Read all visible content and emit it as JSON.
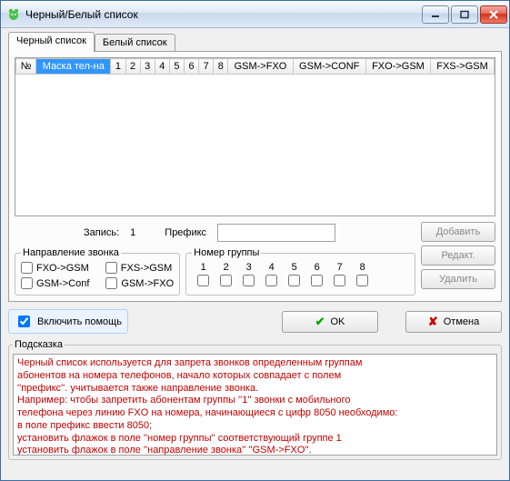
{
  "window": {
    "title": "Черный/Белый список"
  },
  "tabs": {
    "black": "Черный список",
    "white": "Белый список"
  },
  "table": {
    "headers": [
      "№",
      "Маска тел-на",
      "1",
      "2",
      "3",
      "4",
      "5",
      "6",
      "7",
      "8",
      "GSM->FXO",
      "GSM->CONF",
      "FXO->GSM",
      "FXS->GSM"
    ]
  },
  "record": {
    "label": "Запись:",
    "value": "1",
    "prefix_label": "Префикс",
    "prefix_value": ""
  },
  "direction": {
    "legend": "Направление звонка",
    "fxo_gsm": "FXO->GSM",
    "fxs_gsm": "FXS->GSM",
    "gsm_conf": "GSM->Conf",
    "gsm_fxo": "GSM->FXO"
  },
  "group": {
    "legend": "Номер группы",
    "nums": [
      "1",
      "2",
      "3",
      "4",
      "5",
      "6",
      "7",
      "8"
    ]
  },
  "buttons": {
    "add": "Добавить",
    "edit": "Редакт.",
    "del": "Удалить",
    "ok": "OK",
    "cancel": "Отмена"
  },
  "help": {
    "label": "Включить помощь"
  },
  "hint": {
    "legend": "Подсказка",
    "lines": [
      "Черный список используется для запрета звонков определенным группам",
      "абонентов на номера телефонов, начало которых совпадает с полем",
      "''префикс''. учитывается также направление звонка.",
      "Например: чтобы запретить абонентам группы ''1'' звонки с мобильного",
      "телефона через линию FXO на номера, начинающиеся с цифр 8050 необходимо:",
      "в поле префикс ввести 8050;",
      "установить флажок  в поле ''номер группы'' соответствующий группе 1",
      "установить флажок в поле ''направление звонка'' ''GSM->FXO''."
    ]
  }
}
